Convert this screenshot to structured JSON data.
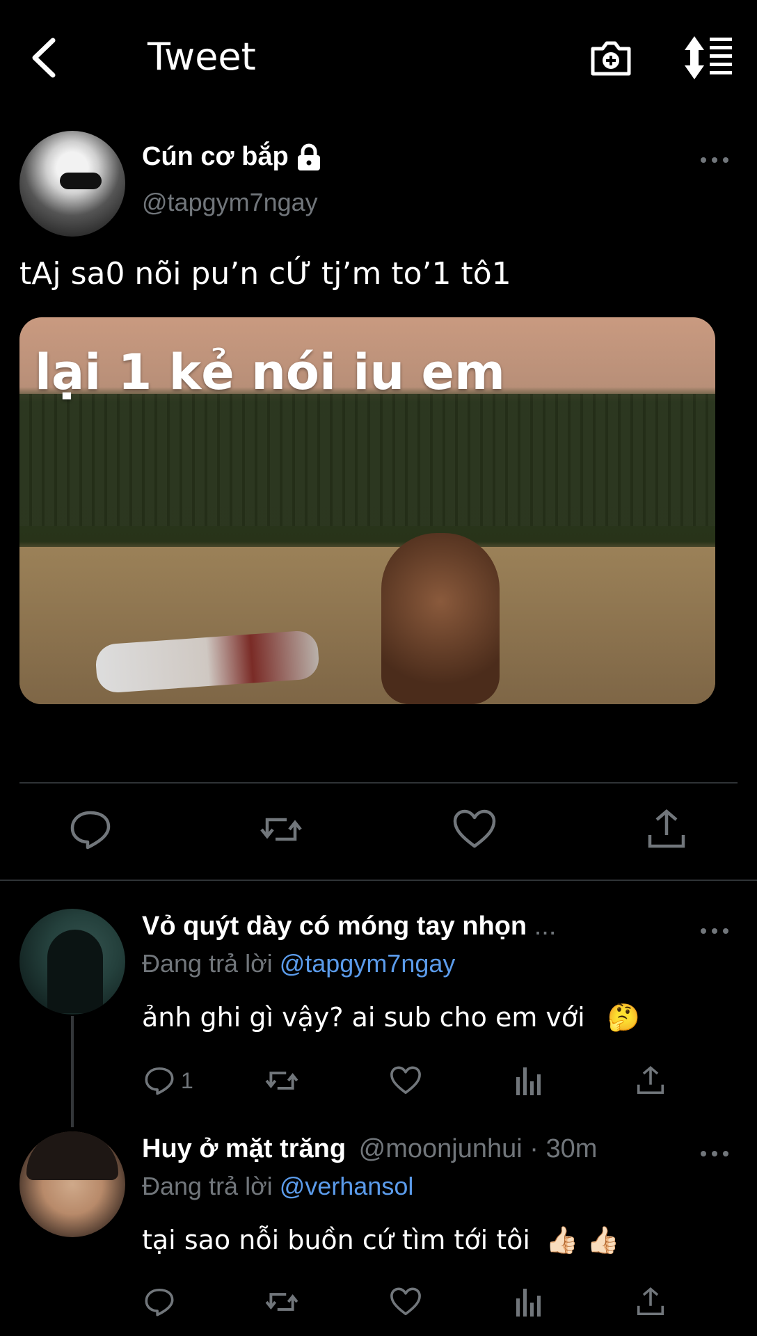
{
  "header": {
    "title": "Tweet",
    "back_icon": "chevron-left-icon",
    "camera_icon": "camera-plus-icon",
    "sort_icon": "sort-icon"
  },
  "main_tweet": {
    "display_name": "Cún cơ bắp",
    "handle": "@tapgym7ngay",
    "text": "tAj sa0 nõi pu’n cỨ tj’m to’1 tô1",
    "media_caption": "lại 1 kẻ nói iu em",
    "protected_icon": "lock-icon"
  },
  "replies": [
    {
      "display_name": "Vỏ quýt dày có móng tay nhọn",
      "meta": "...",
      "replying_label": "Đang trả lời",
      "replying_to": "@tapgym7ngay",
      "text": "ảnh ghi gì vậy? ai sub cho em với",
      "emoji": "🤔",
      "reply_count": "1"
    },
    {
      "display_name": "Huy ở mặt trăng",
      "meta": "@moonjunhui · 30m",
      "replying_label": "Đang trả lời",
      "replying_to": "@verhansol",
      "text": "tại sao nỗi buồn cứ tìm tới tôi",
      "emoji": "👍🏻 👍🏻"
    }
  ],
  "colors": {
    "background": "#000000",
    "text": "#ffffff",
    "muted": "#71767b",
    "link": "#5b9bea",
    "divider": "#2f3336"
  }
}
